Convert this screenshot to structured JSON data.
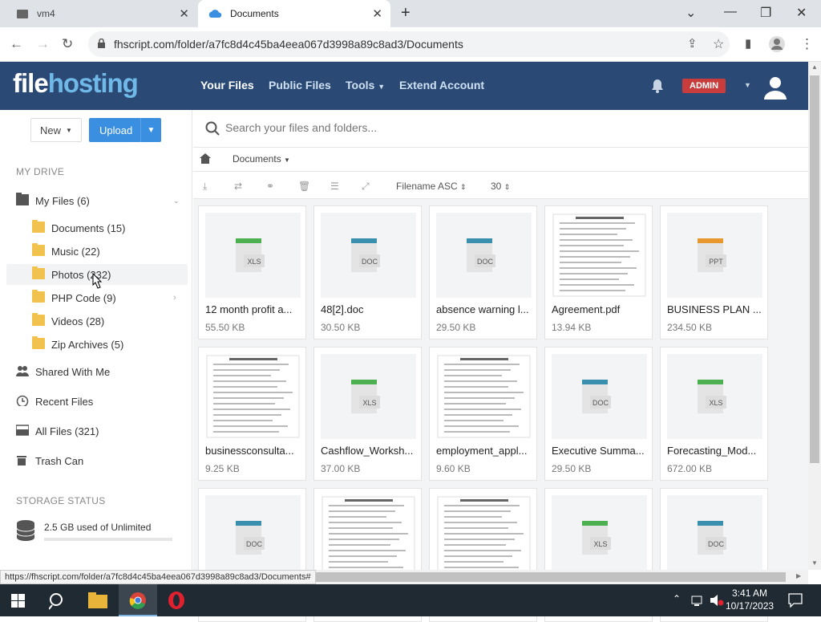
{
  "browser": {
    "tabs": [
      {
        "title": "vm4",
        "active": false
      },
      {
        "title": "Documents",
        "active": true
      }
    ],
    "url": "fhscript.com/folder/a7fc8d4c45ba4eea067d3998a89c8ad3/Documents",
    "status_url": "https://fhscript.com/folder/a7fc8d4c45ba4eea067d3998a89c8ad3/Documents#"
  },
  "app": {
    "logo_part1": "file",
    "logo_part2": "hosting",
    "nav": [
      "Your Files",
      "Public Files",
      "Tools",
      "Extend Account"
    ],
    "user_badge": "ADMIN"
  },
  "sidebar": {
    "new_label": "New",
    "upload_label": "Upload",
    "my_drive_heading": "MY DRIVE",
    "my_files": "My Files (6)",
    "folders": [
      "Documents (15)",
      "Music (22)",
      "Photos (232)",
      "PHP Code (9)",
      "Videos (28)",
      "Zip Archives (5)"
    ],
    "shared": "Shared With Me",
    "recent": "Recent Files",
    "all_files": "All Files (321)",
    "trash": "Trash Can",
    "storage_heading": "STORAGE STATUS",
    "storage_text": "2.5 GB used of Unlimited"
  },
  "main": {
    "search_placeholder": "Search your files and folders...",
    "breadcrumb": "Documents",
    "sort_label": "Filename ASC",
    "per_page": "30",
    "files": [
      {
        "name": "12 month profit a...",
        "size": "55.50 KB",
        "type": "XLS"
      },
      {
        "name": "48[2].doc",
        "size": "30.50 KB",
        "type": "DOC"
      },
      {
        "name": "absence warning l...",
        "size": "29.50 KB",
        "type": "DOC"
      },
      {
        "name": "Agreement.pdf",
        "size": "13.94 KB",
        "type": "PDF"
      },
      {
        "name": "BUSINESS PLAN ...",
        "size": "234.50 KB",
        "type": "PPT"
      },
      {
        "name": "businessconsulta...",
        "size": "9.25 KB",
        "type": "PDF"
      },
      {
        "name": "Cashflow_Worksh...",
        "size": "37.00 KB",
        "type": "XLS"
      },
      {
        "name": "employment_appl...",
        "size": "9.60 KB",
        "type": "PDF"
      },
      {
        "name": "Executive Summa...",
        "size": "29.50 KB",
        "type": "DOC"
      },
      {
        "name": "Forecasting_Mod...",
        "size": "672.00 KB",
        "type": "XLS"
      },
      {
        "name": "",
        "size": "",
        "type": "DOC"
      },
      {
        "name": "",
        "size": "",
        "type": "PDF"
      },
      {
        "name": "",
        "size": "",
        "type": "PDF"
      },
      {
        "name": "",
        "size": "",
        "type": "XLS"
      },
      {
        "name": "",
        "size": "",
        "type": "DOC"
      }
    ]
  },
  "taskbar": {
    "time": "3:41 AM",
    "date": "10/17/2023"
  },
  "colors": {
    "header_bg": "#2a4a75",
    "logo_accent": "#6fb8e8",
    "upload_btn": "#3a8fe0",
    "admin_badge": "#c83c3c",
    "folder": "#f2c24f"
  }
}
